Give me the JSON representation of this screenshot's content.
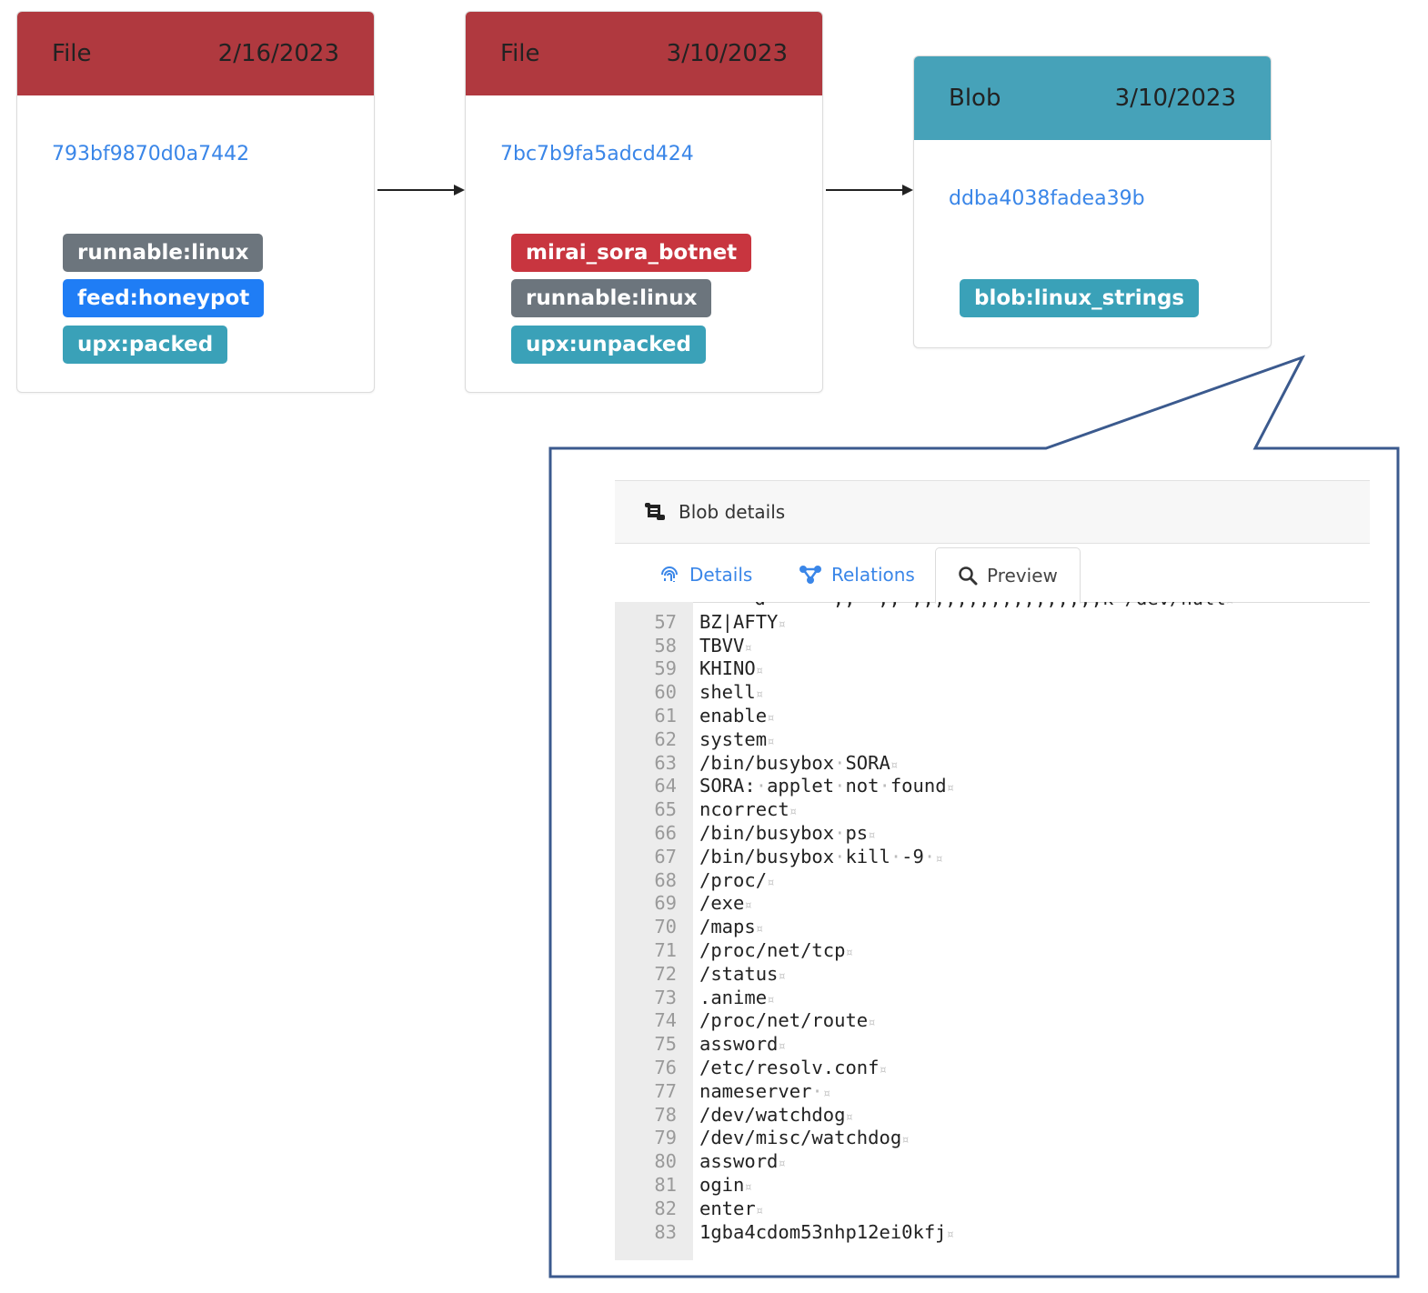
{
  "colors": {
    "file_header": "#b0393f",
    "blob_header": "#46a2b9",
    "tag_gray": "#6c757d",
    "tag_blue": "#1f7df5",
    "tag_teal": "#3aa1b8",
    "tag_red": "#c8353f",
    "link": "#3a86e8",
    "callout_border": "#3b5a8e"
  },
  "nodes": [
    {
      "type": "File",
      "date": "2/16/2023",
      "hash": "793bf9870d0a7442",
      "tags": [
        {
          "label": "runnable:linux",
          "color": "gray"
        },
        {
          "label": "feed:honeypot",
          "color": "blue"
        },
        {
          "label": "upx:packed",
          "color": "teal"
        }
      ]
    },
    {
      "type": "File",
      "date": "3/10/2023",
      "hash": "7bc7b9fa5adcd424",
      "tags": [
        {
          "label": "mirai_sora_botnet",
          "color": "red"
        },
        {
          "label": "runnable:linux",
          "color": "gray"
        },
        {
          "label": "upx:unpacked",
          "color": "teal"
        }
      ]
    },
    {
      "type": "Blob",
      "date": "3/10/2023",
      "hash": "ddba4038fadea39b",
      "tags": [
        {
          "label": "blob:linux_strings",
          "color": "teal"
        }
      ]
    }
  ],
  "panel": {
    "title": "Blob details",
    "tabs": [
      {
        "label": "Details",
        "icon": "fingerprint-icon"
      },
      {
        "label": "Relations",
        "icon": "relations-icon"
      },
      {
        "label": "Preview",
        "icon": "search-icon",
        "active": true
      }
    ],
    "partial_top_line": "-d------,,--,,-,,,,,,,,,,,,,,,,,k-/dev/null",
    "lines": [
      {
        "n": "57",
        "t": "BZ|AFTY"
      },
      {
        "n": "58",
        "t": "TBVV"
      },
      {
        "n": "59",
        "t": "KHINO"
      },
      {
        "n": "60",
        "t": "shell"
      },
      {
        "n": "61",
        "t": "enable"
      },
      {
        "n": "62",
        "t": "system"
      },
      {
        "n": "63",
        "t": "/bin/busybox·SORA"
      },
      {
        "n": "64",
        "t": "SORA:·applet·not·found"
      },
      {
        "n": "65",
        "t": "ncorrect"
      },
      {
        "n": "66",
        "t": "/bin/busybox·ps"
      },
      {
        "n": "67",
        "t": "/bin/busybox·kill·-9·"
      },
      {
        "n": "68",
        "t": "/proc/"
      },
      {
        "n": "69",
        "t": "/exe"
      },
      {
        "n": "70",
        "t": "/maps"
      },
      {
        "n": "71",
        "t": "/proc/net/tcp"
      },
      {
        "n": "72",
        "t": "/status"
      },
      {
        "n": "73",
        "t": ".anime"
      },
      {
        "n": "74",
        "t": "/proc/net/route"
      },
      {
        "n": "75",
        "t": "assword"
      },
      {
        "n": "76",
        "t": "/etc/resolv.conf"
      },
      {
        "n": "77",
        "t": "nameserver·"
      },
      {
        "n": "78",
        "t": "/dev/watchdog"
      },
      {
        "n": "79",
        "t": "/dev/misc/watchdog"
      },
      {
        "n": "80",
        "t": "assword"
      },
      {
        "n": "81",
        "t": "ogin"
      },
      {
        "n": "82",
        "t": "enter"
      },
      {
        "n": "83",
        "t": "1gba4cdom53nhp12ei0kfj"
      }
    ],
    "eol_marker": "¤"
  }
}
